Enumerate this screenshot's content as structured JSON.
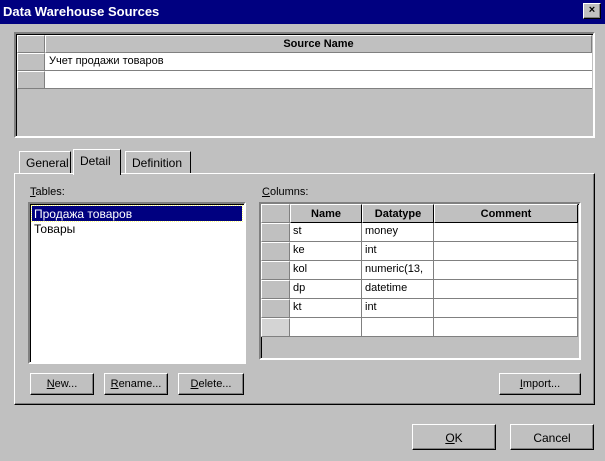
{
  "window": {
    "title": "Data Warehouse Sources",
    "close_label": "×"
  },
  "sources": {
    "header": "Source Name",
    "rows": [
      "Учет продажи товаров",
      ""
    ]
  },
  "tabs": [
    "General",
    "Detail",
    "Definition"
  ],
  "active_tab": "Detail",
  "tables": {
    "label_prefix": "T",
    "label_rest": "ables:",
    "items": [
      "Продажа товаров",
      "Товары"
    ],
    "selected": "Продажа товаров"
  },
  "columns": {
    "label_prefix": "C",
    "label_rest": "olumns:",
    "headers": [
      "Name",
      "Datatype",
      "Comment"
    ],
    "rows": [
      [
        "st",
        "money",
        ""
      ],
      [
        "ke",
        "int",
        ""
      ],
      [
        "kol",
        "numeric(13,",
        ""
      ],
      [
        "dp",
        "datetime",
        ""
      ],
      [
        "kt",
        "int",
        ""
      ],
      [
        "",
        "",
        ""
      ]
    ]
  },
  "buttons": {
    "new": {
      "u": "N",
      "rest": "ew..."
    },
    "rename": {
      "u": "R",
      "rest": "ename..."
    },
    "delete": {
      "u": "D",
      "rest": "elete..."
    },
    "import": {
      "u": "I",
      "rest": "mport..."
    },
    "ok": {
      "u": "O",
      "rest": "K"
    },
    "cancel": "Cancel"
  }
}
